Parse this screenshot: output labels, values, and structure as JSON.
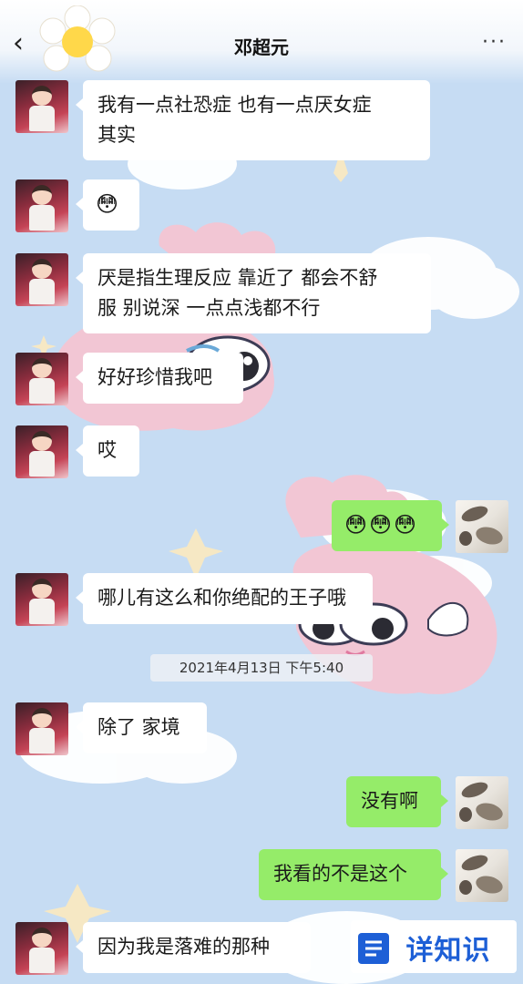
{
  "header": {
    "back_icon": "chevron-left-icon",
    "title": "邓超元",
    "more_icon": "more-dots-icon",
    "back_glyph": "‹",
    "more_glyph": "···"
  },
  "messages": [
    {
      "side": "left",
      "text_lines": [
        "我有一点社恐症 也有一点厌女症",
        "其实"
      ]
    },
    {
      "side": "left",
      "text": "😳",
      "kind": "emoji"
    },
    {
      "side": "left",
      "text_lines": [
        "厌是指生理反应 靠近了 都会不舒",
        "服 别说深 一点点浅都不行"
      ]
    },
    {
      "side": "left",
      "text": "好好珍惜我吧"
    },
    {
      "side": "left",
      "text": "哎"
    },
    {
      "side": "right",
      "text": "😳😳😳",
      "kind": "emoji"
    },
    {
      "side": "left",
      "text": "哪儿有这么和你绝配的王子哦"
    },
    {
      "side": "left",
      "text": "除了 家境"
    },
    {
      "side": "right",
      "text": "没有啊"
    },
    {
      "side": "right",
      "text": "我看的不是这个"
    },
    {
      "side": "left",
      "text": "因为我是落难的那种"
    }
  ],
  "timestamp": "2021年4月13日 下午5:40",
  "watermark": {
    "text": "详知识",
    "logo_icon": "watermark-logo-icon"
  },
  "colors": {
    "background": "#c6dcf3",
    "bubble_left": "#ffffff",
    "bubble_right": "#95ec69",
    "watermark_blue": "#1d5fd6"
  }
}
